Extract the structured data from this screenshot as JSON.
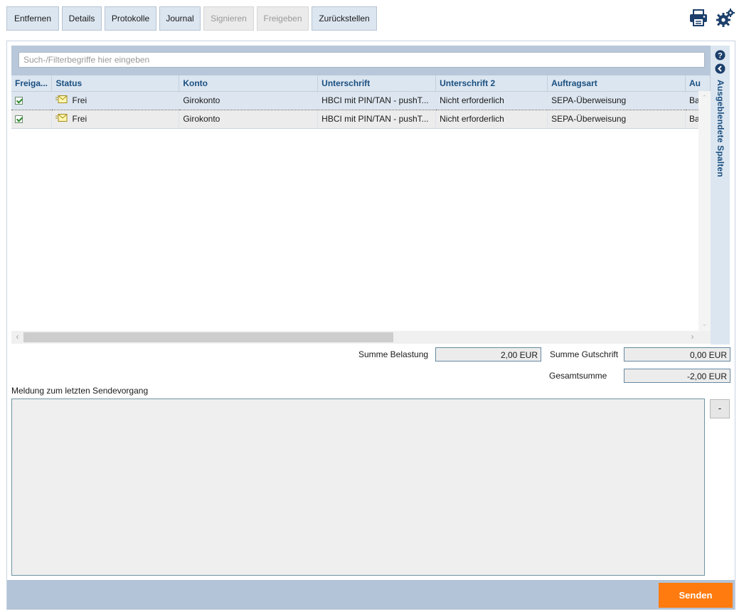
{
  "toolbar": {
    "buttons": [
      {
        "label": "Entfernen",
        "enabled": true
      },
      {
        "label": "Details",
        "enabled": true
      },
      {
        "label": "Protokolle",
        "enabled": true
      },
      {
        "label": "Journal",
        "enabled": true
      },
      {
        "label": "Signieren",
        "enabled": false
      },
      {
        "label": "Freigeben",
        "enabled": false
      },
      {
        "label": "Zurückstellen",
        "enabled": true
      }
    ],
    "icons": [
      "printer-icon",
      "gears-icon"
    ]
  },
  "filter": {
    "placeholder": "Such-/Filterbegriffe hier eingeben",
    "value": ""
  },
  "table": {
    "columns": [
      "Freiga...",
      "Status",
      "Konto",
      "Unterschrift",
      "Unterschrift 2",
      "Auftragsart",
      "Au"
    ],
    "rows": [
      {
        "freigabe": true,
        "status": "Frei",
        "konto": "Girokonto",
        "unterschrift": "HBCI mit PIN/TAN - pushT...",
        "unterschrift2": "Nicht erforderlich",
        "auftragsart": "SEPA-Überweisung",
        "au": "Ba"
      },
      {
        "freigabe": true,
        "status": "Frei",
        "konto": "Girokonto",
        "unterschrift": "HBCI mit PIN/TAN - pushT...",
        "unterschrift2": "Nicht erforderlich",
        "auftragsart": "SEPA-Überweisung",
        "au": "Ba"
      }
    ]
  },
  "side_panel": {
    "label": "Ausgeblendete Spalten",
    "icons": [
      "help-icon",
      "collapse-left-icon"
    ]
  },
  "sums": {
    "belastung_label": "Summe Belastung",
    "belastung_value": "2,00 EUR",
    "gutschrift_label": "Summe Gutschrift",
    "gutschrift_value": "0,00 EUR",
    "gesamt_label": "Gesamtsumme",
    "gesamt_value": "-2,00 EUR"
  },
  "message": {
    "label": "Meldung zum letzten Sendevorgang",
    "text": "",
    "toggle_label": "-"
  },
  "footer": {
    "send_label": "Senden"
  },
  "colors": {
    "accent": "#ff7b0f",
    "header_blue": "#1a4f80",
    "panel_blue": "#b3c3d8",
    "header_bg": "#dce6f0"
  }
}
